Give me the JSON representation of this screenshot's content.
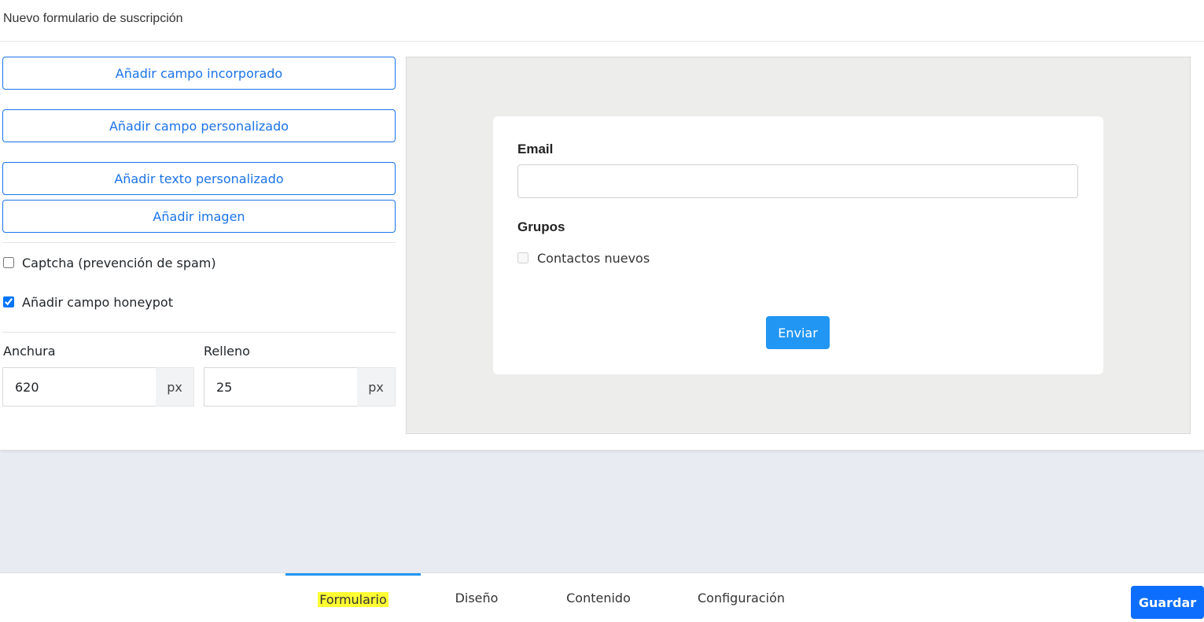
{
  "header": {
    "title": "Nuevo formulario de suscripción"
  },
  "actions": {
    "add_builtin_field": "Añadir campo incorporado",
    "add_custom_field": "Añadir campo personalizado",
    "add_custom_text": "Añadir texto personalizado",
    "add_image": "Añadir imagen"
  },
  "options": {
    "captcha": {
      "label": "Captcha (prevención de spam)",
      "checked": false
    },
    "honeypot": {
      "label": "Añadir campo honeypot",
      "checked": true
    }
  },
  "dimensions": {
    "width": {
      "label": "Anchura",
      "value": "620",
      "unit": "px"
    },
    "padding": {
      "label": "Relleno",
      "value": "25",
      "unit": "px"
    }
  },
  "preview": {
    "email_label": "Email",
    "email_value": "",
    "groups_label": "Grupos",
    "group_item": "Contactos nuevos",
    "submit_label": "Enviar"
  },
  "tabs": [
    {
      "label": "Formulario",
      "active": true
    },
    {
      "label": "Diseño",
      "active": false
    },
    {
      "label": "Contenido",
      "active": false
    },
    {
      "label": "Configuración",
      "active": false
    }
  ],
  "save_label": "Guardar",
  "colors": {
    "accent": "#1a73e8",
    "submit": "#2196f3",
    "save": "#0d6efd",
    "highlight": "#ffff33"
  }
}
